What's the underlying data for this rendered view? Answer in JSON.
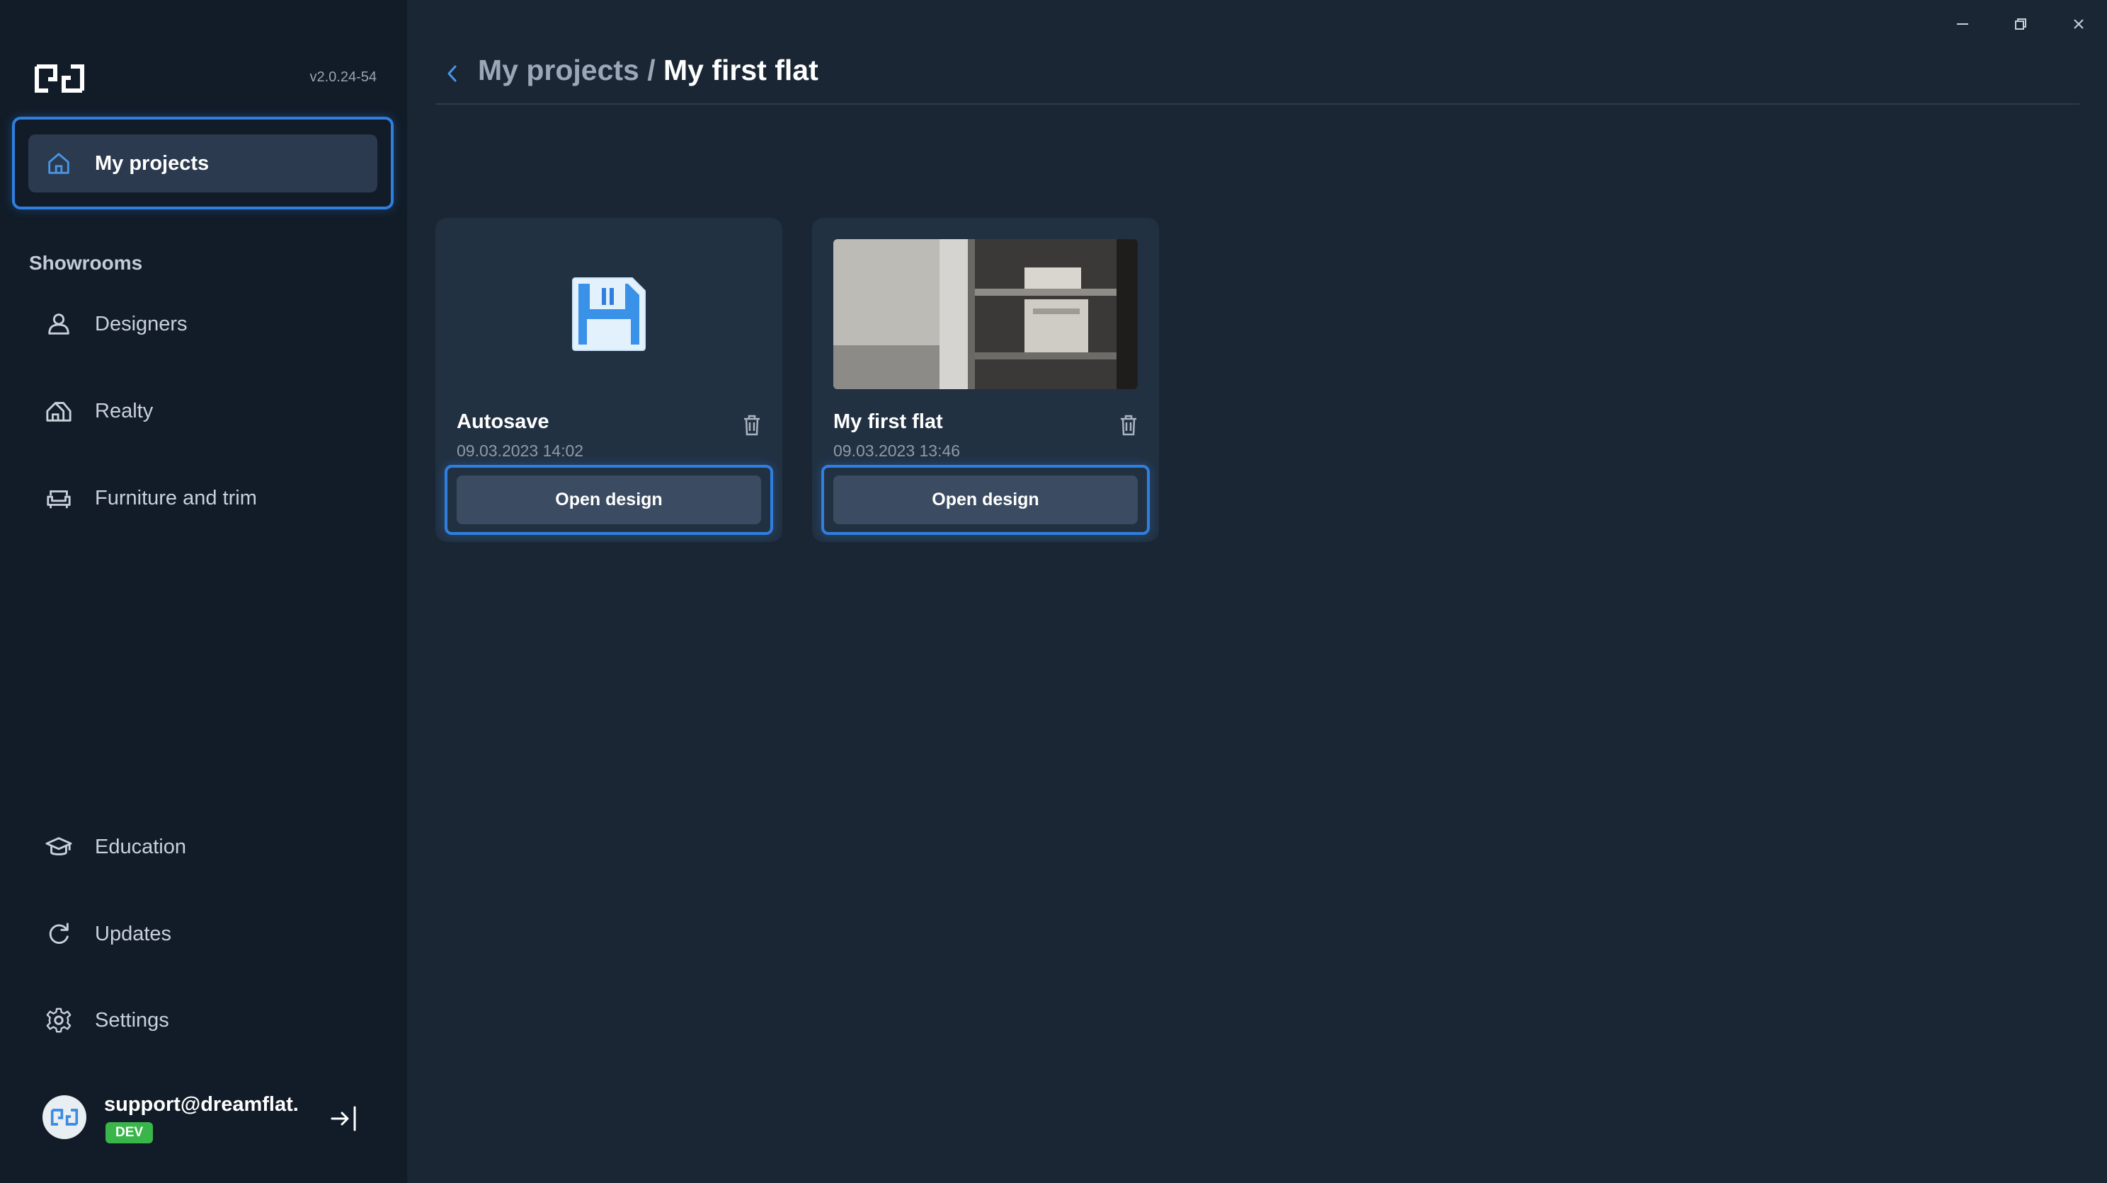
{
  "app": {
    "version": "v2.0.24-54"
  },
  "sidebar": {
    "primary": {
      "label": "My projects",
      "icon": "home-icon"
    },
    "showrooms_label": "Showrooms",
    "showrooms": [
      {
        "label": "Designers",
        "icon": "designers-icon"
      },
      {
        "label": "Realty",
        "icon": "realty-icon"
      },
      {
        "label": "Furniture and trim",
        "icon": "furniture-icon"
      }
    ],
    "bottom": [
      {
        "label": "Education",
        "icon": "education-icon"
      },
      {
        "label": "Updates",
        "icon": "refresh-icon"
      },
      {
        "label": "Settings",
        "icon": "gear-icon"
      }
    ],
    "user": {
      "email": "support@dreamflat.c",
      "badge": "DEV"
    }
  },
  "header": {
    "breadcrumb_parent": "My projects",
    "breadcrumb_separator": " / ",
    "breadcrumb_current": "My first flat"
  },
  "projects": [
    {
      "title": "Autosave",
      "date": "09.03.2023 14:02",
      "thumbnail": "floppy-disk-icon",
      "open_label": "Open design"
    },
    {
      "title": "My first flat",
      "date": "09.03.2023 13:46",
      "thumbnail": "room-photo",
      "open_label": "Open design"
    }
  ],
  "colors": {
    "accent": "#2f7fe0",
    "sidebar_bg": "#121c28",
    "main_bg": "#1a2634",
    "card_bg": "#223142",
    "badge_green": "#3ab54a"
  }
}
